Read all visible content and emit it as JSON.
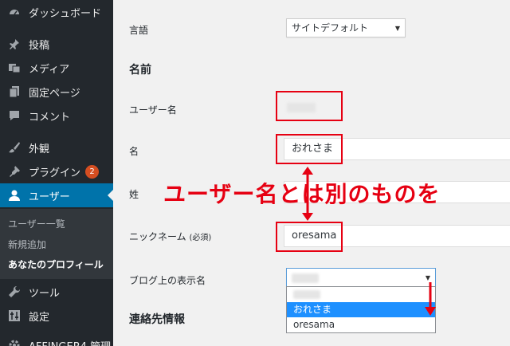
{
  "sidebar": {
    "items": [
      {
        "label": "ダッシュボード",
        "icon": "dashboard-icon"
      },
      {
        "label": "投稿",
        "icon": "pin-icon"
      },
      {
        "label": "メディア",
        "icon": "media-icon"
      },
      {
        "label": "固定ページ",
        "icon": "page-icon"
      },
      {
        "label": "コメント",
        "icon": "comment-icon"
      },
      {
        "label": "外観",
        "icon": "brush-icon"
      },
      {
        "label": "プラグイン",
        "icon": "plugin-icon",
        "badge": "2"
      },
      {
        "label": "ユーザー",
        "icon": "user-icon"
      },
      {
        "label": "ツール",
        "icon": "wrench-icon"
      },
      {
        "label": "設定",
        "icon": "settings-icon"
      },
      {
        "label": "AFFINGER4 管理",
        "icon": "gear-icon"
      }
    ],
    "submenu": [
      "ユーザー一覧",
      "新規追加",
      "あなたのプロフィール"
    ]
  },
  "form": {
    "language_label": "言語",
    "language_value": "サイトデフォルト",
    "name_heading": "名前",
    "username_label": "ユーザー名",
    "firstname_label": "名",
    "firstname_value": "おれさま",
    "lastname_label": "姓",
    "nickname_label": "ニックネーム",
    "nickname_required": "(必須)",
    "nickname_value": "oresama",
    "display_label": "ブログ上の表示名",
    "contact_heading": "連絡先情報",
    "display_options": [
      "おれさま",
      "oresama"
    ]
  },
  "annotation": "ユーザー名とは別のものを",
  "colors": {
    "accent": "#0073aa",
    "annotation": "#e60012",
    "badge": "#d54e21"
  }
}
